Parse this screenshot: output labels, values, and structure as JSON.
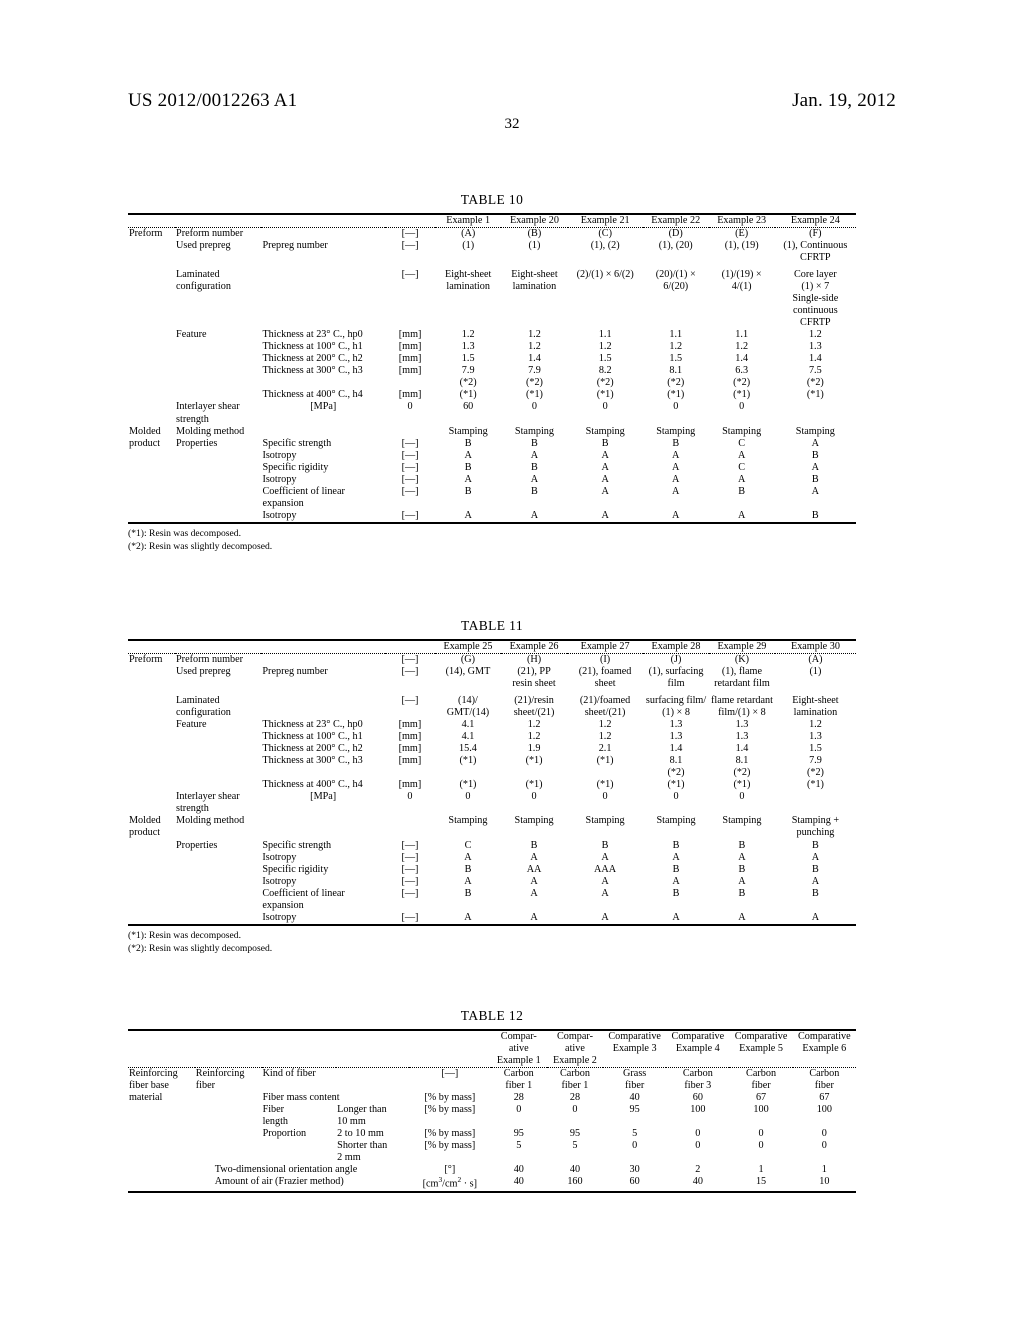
{
  "header": {
    "publication_number": "US 2012/0012263 A1",
    "publication_date": "Jan. 19, 2012",
    "page_number": "32"
  },
  "footnotes": {
    "star1": "(*1): Resin was decomposed.",
    "star2": "(*2): Resin was slightly decomposed."
  },
  "units": {
    "dash": "[—]",
    "mm": "[mm]",
    "mpa": "[MPa]",
    "pct_mass": "[% by mass]",
    "degree": "[°]",
    "frazier": "[cm3/cm2 · s]"
  },
  "table10": {
    "caption": "TABLE 10",
    "columns": [
      "Example 1",
      "Example 20",
      "Example 21",
      "Example 22",
      "Example 23",
      "Example 24"
    ],
    "groups": {
      "preform": "Preform",
      "molded_product": "Molded\nproduct"
    },
    "rows": [
      {
        "l1": "Preform number",
        "l2": "",
        "unit": "[—]",
        "values": [
          "(A)",
          "(B)",
          "(C)",
          "(D)",
          "(E)",
          "(F)"
        ]
      },
      {
        "l1": "Used prepreg",
        "l2": "Prepreg number",
        "unit": "[—]",
        "values": [
          "(1)",
          "(1)",
          "(1), (2)",
          "(1), (20)",
          "(1), (19)",
          "(1), Continuous\nCFRTP"
        ]
      },
      {
        "l1": "Laminated\nconfiguration",
        "l2": "",
        "unit": "[—]",
        "values": [
          "Eight-sheet\nlamination",
          "Eight-sheet\nlamination",
          "(2)/(1) × 6/(2)",
          "(20)/(1) ×\n6/(20)",
          "(1)/(19) ×\n4/(1)",
          "Core layer\n(1) × 7\nSingle-side\ncontinuous\nCFRTP"
        ]
      },
      {
        "l1": "Feature",
        "l2": "Thickness at 23° C., hp0",
        "unit": "[mm]",
        "values": [
          "1.2",
          "1.2",
          "1.1",
          "1.1",
          "1.1",
          "1.2"
        ]
      },
      {
        "l1": "",
        "l2": "Thickness at 100° C., h1",
        "unit": "[mm]",
        "values": [
          "1.3",
          "1.2",
          "1.2",
          "1.2",
          "1.2",
          "1.3"
        ]
      },
      {
        "l1": "",
        "l2": "Thickness at 200° C., h2",
        "unit": "[mm]",
        "values": [
          "1.5",
          "1.4",
          "1.5",
          "1.5",
          "1.4",
          "1.4"
        ]
      },
      {
        "l1": "",
        "l2": "Thickness at 300° C., h3",
        "unit": "[mm]",
        "values": [
          "7.9\n(*2)",
          "7.9\n(*2)",
          "8.2\n(*2)",
          "8.1\n(*2)",
          "6.3\n(*2)",
          "7.5\n(*2)"
        ]
      },
      {
        "l1": "",
        "l2": "Thickness at 400° C., h4",
        "unit": "[mm]",
        "values": [
          "(*1)",
          "(*1)",
          "(*1)",
          "(*1)",
          "(*1)",
          "(*1)"
        ]
      },
      {
        "l1": "",
        "l2": "Interlayer shear strength",
        "unit": "[MPa]",
        "values": [
          "0",
          "60",
          "0",
          "0",
          "0",
          "0"
        ]
      },
      {
        "l1": "Molding method",
        "l2": "",
        "unit": "",
        "values": [
          "Stamping",
          "Stamping",
          "Stamping",
          "Stamping",
          "Stamping",
          "Stamping"
        ]
      },
      {
        "l1": "Properties",
        "l2": "Specific strength",
        "unit": "[—]",
        "values": [
          "B",
          "B",
          "B",
          "B",
          "C",
          "A"
        ]
      },
      {
        "l1": "",
        "l2": "Isotropy",
        "unit": "[—]",
        "values": [
          "A",
          "A",
          "A",
          "A",
          "A",
          "B"
        ]
      },
      {
        "l1": "",
        "l2": "Specific rigidity",
        "unit": "[—]",
        "values": [
          "B",
          "B",
          "A",
          "A",
          "C",
          "A"
        ]
      },
      {
        "l1": "",
        "l2": "Isotropy",
        "unit": "[—]",
        "values": [
          "A",
          "A",
          "A",
          "A",
          "A",
          "B"
        ]
      },
      {
        "l1": "",
        "l2": "Coefficient of linear\nexpansion",
        "unit": "[—]",
        "values": [
          "B",
          "B",
          "A",
          "A",
          "B",
          "A"
        ]
      },
      {
        "l1": "",
        "l2": "Isotropy",
        "unit": "[—]",
        "values": [
          "A",
          "A",
          "A",
          "A",
          "A",
          "B"
        ]
      }
    ]
  },
  "table11": {
    "caption": "TABLE 11",
    "columns": [
      "Example 25",
      "Example 26",
      "Example 27",
      "Example 28",
      "Example 29",
      "Example 30"
    ],
    "groups": {
      "preform": "Preform",
      "molded_product": "Molded\nproduct"
    },
    "rows": [
      {
        "l1": "Preform number",
        "l2": "",
        "unit": "[—]",
        "values": [
          "(G)",
          "(H)",
          "(I)",
          "(J)",
          "(K)",
          "(A)"
        ]
      },
      {
        "l1": "Used prepreg",
        "l2": "Prepreg number",
        "unit": "[—]",
        "values": [
          "(14), GMT",
          "(21), PP\nresin sheet",
          "(21), foamed\nsheet",
          "(1), surfacing\nfilm",
          "(1), flame\nretardant film",
          "(1)"
        ]
      },
      {
        "l1": "Laminated\nconfiguration",
        "l2": "",
        "unit": "[—]",
        "values": [
          "(14)/\nGMT/(14)",
          "(21)/resin\nsheet/(21)",
          "(21)/foamed\nsheet/(21)",
          "surfacing film/\n(1) × 8",
          "flame retardant\nfilm/(1) × 8",
          "Eight-sheet\nlamination"
        ]
      },
      {
        "l1": "Feature",
        "l2": "Thickness at 23° C., hp0",
        "unit": "[mm]",
        "values": [
          "4.1",
          "1.2",
          "1.2",
          "1.3",
          "1.3",
          "1.2"
        ]
      },
      {
        "l1": "",
        "l2": "Thickness at 100° C., h1",
        "unit": "[mm]",
        "values": [
          "4.1",
          "1.2",
          "1.2",
          "1.3",
          "1.3",
          "1.3"
        ]
      },
      {
        "l1": "",
        "l2": "Thickness at 200° C., h2",
        "unit": "[mm]",
        "values": [
          "15.4",
          "1.9",
          "2.1",
          "1.4",
          "1.4",
          "1.5"
        ]
      },
      {
        "l1": "",
        "l2": "Thickness at 300° C., h3",
        "unit": "[mm]",
        "values": [
          "(*1)",
          "(*1)",
          "(*1)",
          "8.1\n(*2)",
          "8.1\n(*2)",
          "7.9\n(*2)"
        ]
      },
      {
        "l1": "",
        "l2": "Thickness at 400° C., h4",
        "unit": "[mm]",
        "values": [
          "(*1)",
          "(*1)",
          "(*1)",
          "(*1)",
          "(*1)",
          "(*1)"
        ]
      },
      {
        "l1": "",
        "l2": "Interlayer shear strength",
        "unit": "[MPa]",
        "values": [
          "0",
          "0",
          "0",
          "0",
          "0",
          "0"
        ]
      },
      {
        "l1": "Molding method",
        "l2": "",
        "unit": "",
        "values": [
          "Stamping",
          "Stamping",
          "Stamping",
          "Stamping",
          "Stamping",
          "Stamping +\npunching"
        ]
      },
      {
        "l1": "Properties",
        "l2": "Specific strength",
        "unit": "[—]",
        "values": [
          "C",
          "B",
          "B",
          "B",
          "B",
          "B"
        ]
      },
      {
        "l1": "",
        "l2": "Isotropy",
        "unit": "[—]",
        "values": [
          "A",
          "A",
          "A",
          "A",
          "A",
          "A"
        ]
      },
      {
        "l1": "",
        "l2": "Specific rigidity",
        "unit": "[—]",
        "values": [
          "B",
          "AA",
          "AAA",
          "B",
          "B",
          "B"
        ]
      },
      {
        "l1": "",
        "l2": "Isotropy",
        "unit": "[—]",
        "values": [
          "A",
          "A",
          "A",
          "A",
          "A",
          "A"
        ]
      },
      {
        "l1": "",
        "l2": "Coefficient of linear\nexpansion",
        "unit": "[—]",
        "values": [
          "B",
          "A",
          "A",
          "B",
          "B",
          "B"
        ]
      },
      {
        "l1": "",
        "l2": "Isotropy",
        "unit": "[—]",
        "values": [
          "A",
          "A",
          "A",
          "A",
          "A",
          "A"
        ]
      }
    ]
  },
  "table12": {
    "caption": "TABLE 12",
    "columns": [
      "Compar-\native\nExample 1",
      "Compar-\native\nExample 2",
      "Comparative\nExample 3",
      "Comparative\nExample 4",
      "Comparative\nExample 5",
      "Comparative\nExample 6"
    ],
    "groups": {
      "base_material": "Reinforcing\nfiber base\nmaterial",
      "fiber": "Reinforcing\nfiber"
    },
    "rows": [
      {
        "l2": "Kind of fiber",
        "l3": "",
        "unit": "[—]",
        "values": [
          "Carbon\nfiber 1",
          "Carbon\nfiber 1",
          "Grass\nfiber",
          "Carbon\nfiber 3",
          "Carbon\nfiber",
          "Carbon\nfiber"
        ]
      },
      {
        "l2": "Fiber mass content",
        "l3": "",
        "unit": "[% by mass]",
        "values": [
          "28",
          "28",
          "40",
          "60",
          "67",
          "67"
        ]
      },
      {
        "l2": "Fiber\nlength",
        "l3": "Longer than\n10 mm",
        "unit": "[% by mass]",
        "values": [
          "0",
          "0",
          "95",
          "100",
          "100",
          "100"
        ]
      },
      {
        "l2": "Proportion",
        "l3": "2 to 10 mm",
        "unit": "[% by mass]",
        "values": [
          "95",
          "95",
          "5",
          "0",
          "0",
          "0"
        ]
      },
      {
        "l2": "",
        "l3": "Shorter than\n2 mm",
        "unit": "[% by mass]",
        "values": [
          "5",
          "5",
          "0",
          "0",
          "0",
          "0"
        ]
      },
      {
        "l2": "Two-dimensional orientation angle",
        "l3": "",
        "unit": "[°]",
        "values": [
          "40",
          "40",
          "30",
          "2",
          "1",
          "1"
        ]
      },
      {
        "l2": "Amount of air (Frazier method)",
        "l3": "",
        "unit": "[cm3/cm2 · s]",
        "values": [
          "40",
          "160",
          "60",
          "40",
          "15",
          "10"
        ]
      }
    ]
  }
}
